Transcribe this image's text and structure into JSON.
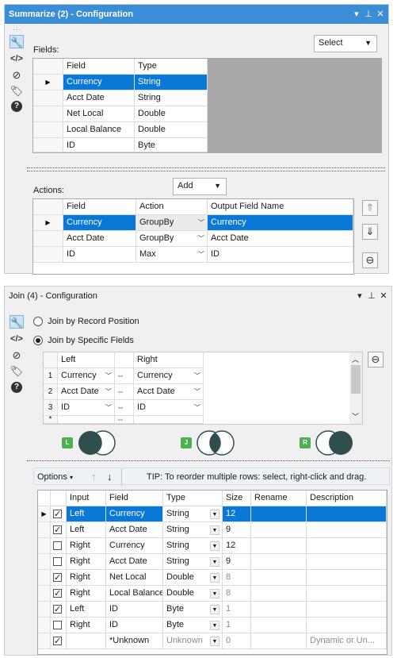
{
  "summarize": {
    "title": "Summarize (2) - Configuration",
    "controls": [
      "▾",
      "⊥",
      "✕"
    ],
    "fields_label": "Fields:",
    "select_label": "Select",
    "fields_headers": [
      "Field",
      "Type"
    ],
    "fields_rows": [
      {
        "field": "Currency",
        "type": "String"
      },
      {
        "field": "Acct Date",
        "type": "String"
      },
      {
        "field": "Net Local",
        "type": "Double"
      },
      {
        "field": "Local Balance",
        "type": "Double"
      },
      {
        "field": "ID",
        "type": "Byte"
      }
    ],
    "actions_label": "Actions:",
    "add_label": "Add",
    "actions_headers": [
      "Field",
      "Action",
      "Output Field Name"
    ],
    "actions_rows": [
      {
        "field": "Currency",
        "action": "GroupBy",
        "output": "Currency"
      },
      {
        "field": "Acct Date",
        "action": "GroupBy",
        "output": "Acct Date"
      },
      {
        "field": "ID",
        "action": "Max",
        "output": "ID"
      }
    ]
  },
  "join": {
    "title": "Join (4) - Configuration",
    "controls": [
      "▾",
      "⊥",
      "✕"
    ],
    "radio_position": "Join by Record Position",
    "radio_specific": "Join by Specific Fields",
    "left_header": "Left",
    "right_header": "Right",
    "join_rows": [
      {
        "num": "1",
        "left": "Currency",
        "right": "Currency"
      },
      {
        "num": "2",
        "left": "Acct Date",
        "right": "Acct Date"
      },
      {
        "num": "3",
        "left": "ID",
        "right": "ID"
      },
      {
        "num": "*",
        "left": "",
        "right": ""
      }
    ],
    "venn_left_label": "L",
    "venn_join_label": "J",
    "venn_right_label": "R",
    "options_label": "Options",
    "tip": "TIP: To reorder multiple rows: select, right-click and drag.",
    "output_headers": [
      "Input",
      "Field",
      "Type",
      "Size",
      "Rename",
      "Description"
    ],
    "output_rows": [
      {
        "checked": true,
        "input": "Left",
        "field": "Currency",
        "type": "String",
        "size": "12",
        "rename": "",
        "desc": ""
      },
      {
        "checked": true,
        "input": "Left",
        "field": "Acct Date",
        "type": "String",
        "size": "9",
        "rename": "",
        "desc": ""
      },
      {
        "checked": false,
        "input": "Right",
        "field": "Currency",
        "type": "String",
        "size": "12",
        "rename": "",
        "desc": ""
      },
      {
        "checked": false,
        "input": "Right",
        "field": "Acct Date",
        "type": "String",
        "size": "9",
        "rename": "",
        "desc": ""
      },
      {
        "checked": true,
        "input": "Right",
        "field": "Net Local",
        "type": "Double",
        "size": "8",
        "rename": "",
        "desc": ""
      },
      {
        "checked": true,
        "input": "Right",
        "field": "Local Balance",
        "type": "Double",
        "size": "8",
        "rename": "",
        "desc": ""
      },
      {
        "checked": true,
        "input": "Left",
        "field": "ID",
        "type": "Byte",
        "size": "1",
        "rename": "",
        "desc": ""
      },
      {
        "checked": false,
        "input": "Right",
        "field": "ID",
        "type": "Byte",
        "size": "1",
        "rename": "",
        "desc": ""
      },
      {
        "checked": true,
        "input": "",
        "field": "*Unknown",
        "type": "Unknown",
        "size": "0",
        "rename": "",
        "desc": "Dynamic or Un..."
      }
    ]
  },
  "colors": {
    "accent": "#3a8ed6",
    "selection": "#0a78d7",
    "venn_dark": "#2f4f4f",
    "venn_badge": "#4caf50"
  }
}
